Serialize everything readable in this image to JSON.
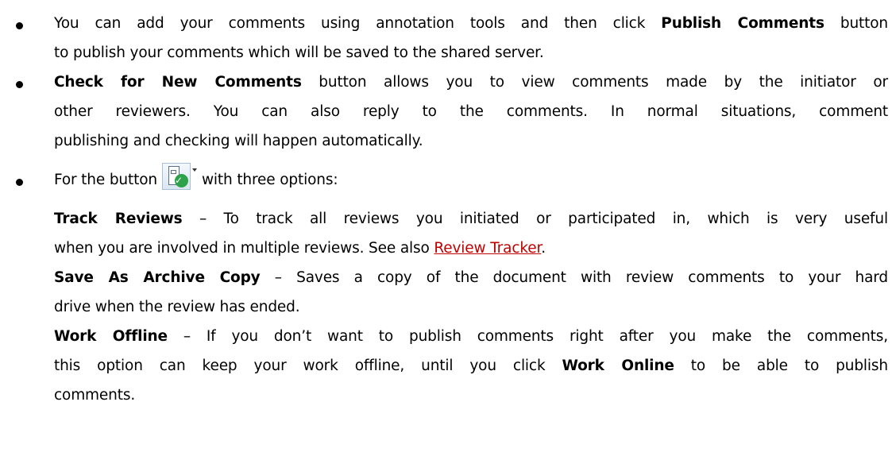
{
  "bullets": [
    {
      "lines": [
        {
          "pre": "You can add your comments using annotation tools and then click ",
          "bold": "Publish Comments",
          "post": " button"
        },
        {
          "text": "to publish your comments which will be saved to the shared server."
        }
      ]
    },
    {
      "lines": [
        {
          "bold": "Check for New Comments",
          "post": " button allows you to view comments made by the initiator or"
        },
        {
          "text": "other reviewers. You can also reply to the comments. In normal situations, comment"
        },
        {
          "text": "publishing and checking will happen automatically."
        }
      ]
    },
    {
      "intro_pre": "For the button",
      "intro_post": "with three options:",
      "button_icon": "review-options-icon",
      "options": [
        {
          "label": "Track Reviews",
          "line1": " – To track all reviews you initiated or participated in, which is very useful",
          "line2_pre": "when you are involved in multiple reviews. See also ",
          "link": "Review Tracker",
          "line2_post": "."
        },
        {
          "label": "Save As Archive Copy",
          "line1": " – Saves a copy of the document with review comments to your hard",
          "line2": "drive when the review has ended."
        },
        {
          "label": "Work Offline",
          "line1": " – If you don’t want to publish comments right after you make the comments,",
          "line2_pre": "this option can keep your work offline, until you click ",
          "bold2": "Work Online",
          "line2_post": " to be able to publish",
          "line3": "comments."
        }
      ]
    }
  ],
  "colors": {
    "text": "#000000",
    "link": "#c00000",
    "check_green": "#2ea24a"
  }
}
